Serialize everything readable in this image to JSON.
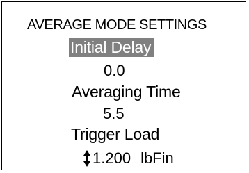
{
  "header": {
    "title": "AVERAGE MODE SETTINGS"
  },
  "settings": [
    {
      "label": "Initial Delay",
      "value": "0.0",
      "selected": true
    },
    {
      "label": "Averaging Time",
      "value": "5.5",
      "selected": false
    },
    {
      "label": "Trigger Load",
      "value": "1.200",
      "unit": "lbFin",
      "selected": false,
      "editor": "up-down-arrow-icon"
    }
  ],
  "colors": {
    "selection_background": "#808080",
    "selection_text": "#ffffff",
    "text": "#000000",
    "background": "#ffffff"
  }
}
